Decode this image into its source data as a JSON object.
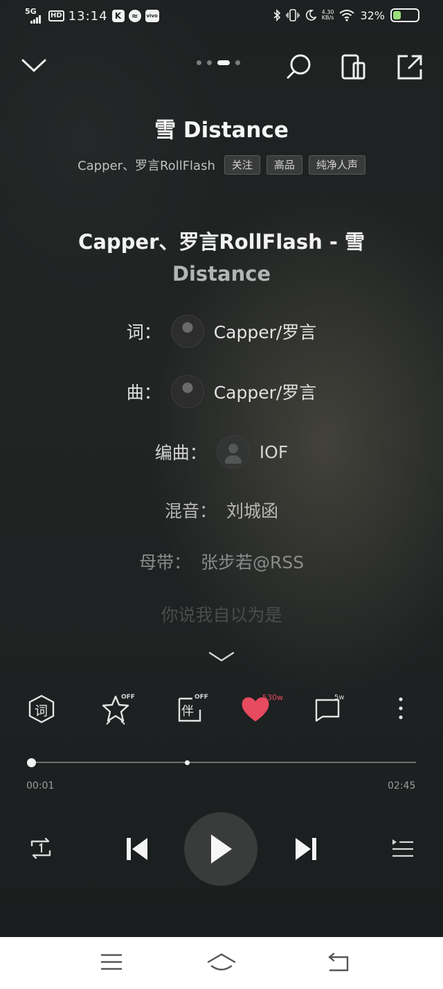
{
  "status_bar": {
    "network": "5G",
    "hd": "HD",
    "time": "13:14",
    "app_icons": [
      "K",
      "≈",
      "vivo"
    ],
    "net_speed_value": "4.30",
    "net_speed_unit": "KB/s",
    "battery_pct_label": "32%",
    "battery_level": 0.32,
    "battery_color": "#9be07a"
  },
  "header": {
    "collapse_icon": "chevron-down-icon",
    "page_dots": 4,
    "active_dot": 2,
    "search_icon": "search-icon",
    "flip_icon": "phone-flip-icon",
    "share_icon": "share-icon"
  },
  "song": {
    "title": "雪 Distance",
    "artist": "Capper、罗言RollFlash",
    "tags": [
      "关注",
      "高品",
      "纯净人声"
    ]
  },
  "lyrics": {
    "title_line1": "Capper、罗言RollFlash - 雪",
    "title_line2": "Distance",
    "credits": [
      {
        "label": "词：",
        "name": "Capper/罗言",
        "avatar": "photo"
      },
      {
        "label": "曲：",
        "name": "Capper/罗言",
        "avatar": "photo"
      },
      {
        "label": "编曲：",
        "name": "IOF",
        "avatar": "placeholder"
      },
      {
        "label": "混音：",
        "name": "刘城函"
      },
      {
        "label": "母带：",
        "name": "张步若@RSS"
      }
    ],
    "next_line": "你说我自以为是"
  },
  "actions": {
    "lyrics_icon_label": "词",
    "effect_badge": "OFF",
    "accompany_label": "伴",
    "accompany_badge": "OFF",
    "like_count": "530w",
    "like_color": "#e84a5f",
    "comment_count": "5w"
  },
  "progress": {
    "current": "00:01",
    "total": "02:45",
    "played_fraction": 0.006,
    "buffered_fraction": 0.4
  },
  "nav": {
    "menu_icon": "menu-icon",
    "home_icon": "home-icon",
    "back_icon": "back-icon"
  }
}
